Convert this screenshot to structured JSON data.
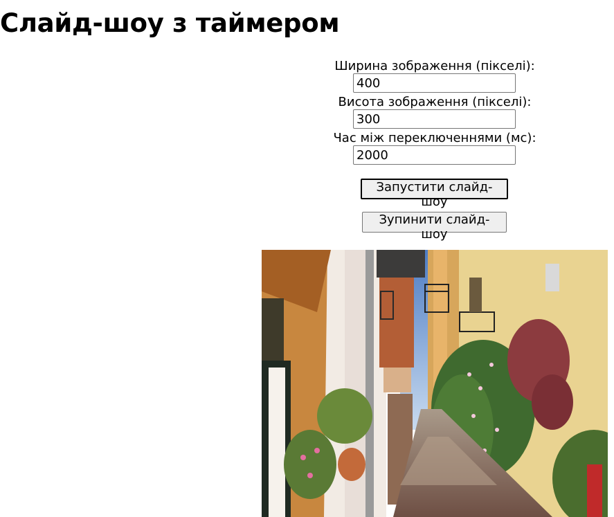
{
  "page": {
    "title": "Слайд-шоу з таймером"
  },
  "form": {
    "width_label": "Ширина зображення (пікселі):",
    "width_value": "400",
    "height_label": "Висота зображення (пікселі):",
    "height_value": "300",
    "interval_label": "Час між переключеннями (мс):",
    "interval_value": "2000",
    "start_button": "Запустити слайд-шоу",
    "stop_button": "Зупинити слайд-шоу"
  },
  "slideshow": {
    "current_image": "photo of narrow cobblestone alley with colorful houses, balconies and flowers"
  }
}
